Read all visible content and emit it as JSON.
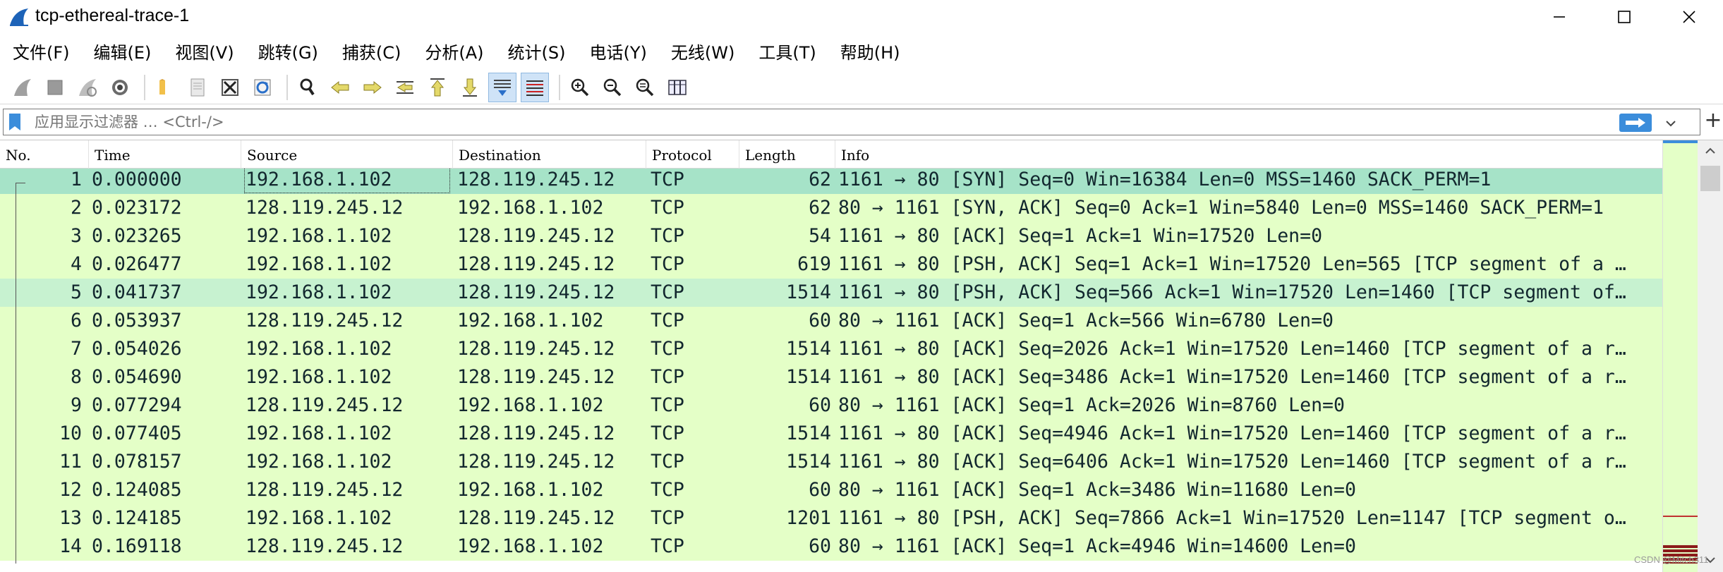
{
  "window": {
    "title": "tcp-ethereal-trace-1"
  },
  "menu": [
    "文件(F)",
    "编辑(E)",
    "视图(V)",
    "跳转(G)",
    "捕获(C)",
    "分析(A)",
    "统计(S)",
    "电话(Y)",
    "无线(W)",
    "工具(T)",
    "帮助(H)"
  ],
  "filter": {
    "placeholder": "应用显示过滤器 … <Ctrl-/>"
  },
  "columns": {
    "no": "No.",
    "time": "Time",
    "source": "Source",
    "destination": "Destination",
    "protocol": "Protocol",
    "length": "Length",
    "info": "Info"
  },
  "packets": [
    {
      "no": "1",
      "time": "0.000000",
      "src": "192.168.1.102",
      "dst": "128.119.245.12",
      "proto": "TCP",
      "len": "62",
      "info": "1161 → 80 [SYN] Seq=0 Win=16384 Len=0 MSS=1460 SACK_PERM=1"
    },
    {
      "no": "2",
      "time": "0.023172",
      "src": "128.119.245.12",
      "dst": "192.168.1.102",
      "proto": "TCP",
      "len": "62",
      "info": "80 → 1161 [SYN, ACK] Seq=0 Ack=1 Win=5840 Len=0 MSS=1460 SACK_PERM=1"
    },
    {
      "no": "3",
      "time": "0.023265",
      "src": "192.168.1.102",
      "dst": "128.119.245.12",
      "proto": "TCP",
      "len": "54",
      "info": "1161 → 80 [ACK] Seq=1 Ack=1 Win=17520 Len=0"
    },
    {
      "no": "4",
      "time": "0.026477",
      "src": "192.168.1.102",
      "dst": "128.119.245.12",
      "proto": "TCP",
      "len": "619",
      "info": "1161 → 80 [PSH, ACK] Seq=1 Ack=1 Win=17520 Len=565 [TCP segment of a …"
    },
    {
      "no": "5",
      "time": "0.041737",
      "src": "192.168.1.102",
      "dst": "128.119.245.12",
      "proto": "TCP",
      "len": "1514",
      "info": "1161 → 80 [PSH, ACK] Seq=566 Ack=1 Win=17520 Len=1460 [TCP segment of…"
    },
    {
      "no": "6",
      "time": "0.053937",
      "src": "128.119.245.12",
      "dst": "192.168.1.102",
      "proto": "TCP",
      "len": "60",
      "info": "80 → 1161 [ACK] Seq=1 Ack=566 Win=6780 Len=0"
    },
    {
      "no": "7",
      "time": "0.054026",
      "src": "192.168.1.102",
      "dst": "128.119.245.12",
      "proto": "TCP",
      "len": "1514",
      "info": "1161 → 80 [ACK] Seq=2026 Ack=1 Win=17520 Len=1460 [TCP segment of a r…"
    },
    {
      "no": "8",
      "time": "0.054690",
      "src": "192.168.1.102",
      "dst": "128.119.245.12",
      "proto": "TCP",
      "len": "1514",
      "info": "1161 → 80 [ACK] Seq=3486 Ack=1 Win=17520 Len=1460 [TCP segment of a r…"
    },
    {
      "no": "9",
      "time": "0.077294",
      "src": "128.119.245.12",
      "dst": "192.168.1.102",
      "proto": "TCP",
      "len": "60",
      "info": "80 → 1161 [ACK] Seq=1 Ack=2026 Win=8760 Len=0"
    },
    {
      "no": "10",
      "time": "0.077405",
      "src": "192.168.1.102",
      "dst": "128.119.245.12",
      "proto": "TCP",
      "len": "1514",
      "info": "1161 → 80 [ACK] Seq=4946 Ack=1 Win=17520 Len=1460 [TCP segment of a r…"
    },
    {
      "no": "11",
      "time": "0.078157",
      "src": "192.168.1.102",
      "dst": "128.119.245.12",
      "proto": "TCP",
      "len": "1514",
      "info": "1161 → 80 [ACK] Seq=6406 Ack=1 Win=17520 Len=1460 [TCP segment of a r…"
    },
    {
      "no": "12",
      "time": "0.124085",
      "src": "128.119.245.12",
      "dst": "192.168.1.102",
      "proto": "TCP",
      "len": "60",
      "info": "80 → 1161 [ACK] Seq=1 Ack=3486 Win=11680 Len=0"
    },
    {
      "no": "13",
      "time": "0.124185",
      "src": "192.168.1.102",
      "dst": "128.119.245.12",
      "proto": "TCP",
      "len": "1201",
      "info": "1161 → 80 [PSH, ACK] Seq=7866 Ack=1 Win=17520 Len=1147 [TCP segment o…"
    },
    {
      "no": "14",
      "time": "0.169118",
      "src": "128.119.245.12",
      "dst": "192.168.1.102",
      "proto": "TCP",
      "len": "60",
      "info": "80 → 1161 [ACK] Seq=1 Ack=4946 Win=14600 Len=0"
    }
  ],
  "watermark": "CSDN @Mitch311",
  "colors": {
    "tcp_row": "#e4ffc7",
    "selected_row": "#a6e3c8",
    "highlight_row": "#c7f2d0",
    "apply_button": "#3b8ddb"
  }
}
